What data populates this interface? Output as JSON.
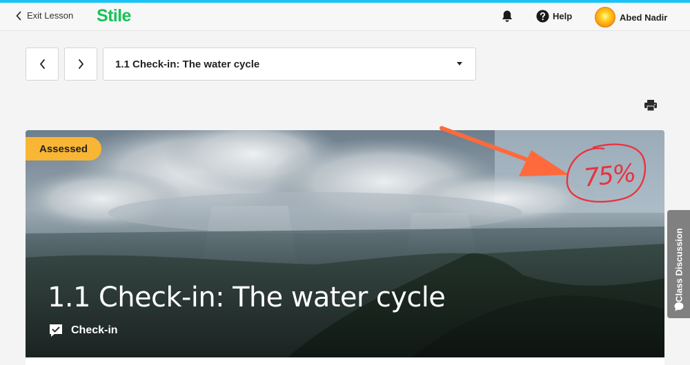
{
  "header": {
    "exit_label": "Exit Lesson",
    "logo": "Stile",
    "help_label": "Help",
    "user_name": "Abed Nadir",
    "icons": [
      "chevron-left-icon",
      "bell-icon",
      "help-circle-icon",
      "avatar"
    ]
  },
  "lesson_nav": {
    "selected_lesson": "1.1 Check-in: The water cycle",
    "icons": [
      "chevron-left-icon",
      "chevron-right-icon",
      "caret-down-icon",
      "print-icon"
    ]
  },
  "hero": {
    "badge": "Assessed",
    "title": "1.1 Check-in: The water cycle",
    "type_label": "Check-in",
    "type_icon": "checkin-chat-icon"
  },
  "annotation": {
    "score": "75%",
    "color": "#e8333f",
    "arrow_color": "#ff6a3d"
  },
  "side_tab": {
    "label": "Class Discussion",
    "icon": "chat-bubble-icon"
  },
  "colors": {
    "brand_green": "#18c25a",
    "top_bar": "#19c3f5",
    "badge": "#f9b534"
  }
}
